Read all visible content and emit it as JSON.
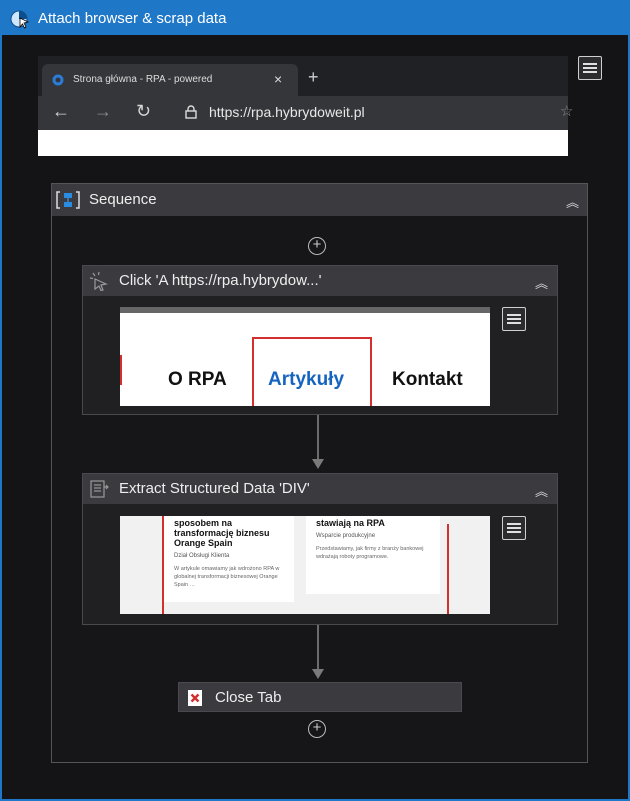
{
  "window": {
    "title": "Attach browser & scrap data"
  },
  "browser": {
    "tab_title": "Strona główna - RPA - powered",
    "tab_close": "×",
    "new_tab": "+",
    "back": "←",
    "forward": "→",
    "reload": "↻",
    "url": "https://rpa.hybrydoweit.pl",
    "star": "☆"
  },
  "sequence": {
    "title": "Sequence",
    "collapse": "︽",
    "add": "+"
  },
  "click_activity": {
    "title": "Click 'A  https://rpa.hybrydow...'",
    "collapse": "︽",
    "menu_items": [
      "O RPA",
      "Artykuły",
      "Kontakt"
    ]
  },
  "extract_activity": {
    "title": "Extract Structured Data 'DIV'",
    "collapse": "︽",
    "card1": {
      "headline": "sposobem na transformację biznesu Orange Spain",
      "author": "Dział Obsługi Klienta",
      "excerpt": "W artykule omawiamy jak wdrożono RPA w globalnej transformacji biznesowej Orange Spain …"
    },
    "card2": {
      "headline": "stawiają na RPA",
      "author": "Wsparcie produkcyjne",
      "excerpt": "Przedstawiamy, jak firmy z branży bankowej wdrażają roboty programowe."
    }
  },
  "close_activity": {
    "title": "Close Tab",
    "add": "+"
  },
  "colors": {
    "titlebar": "#1f77c8",
    "active_tab_border": "#d32f2f",
    "link_blue": "#1565c0",
    "close_red": "#d32f2f"
  }
}
